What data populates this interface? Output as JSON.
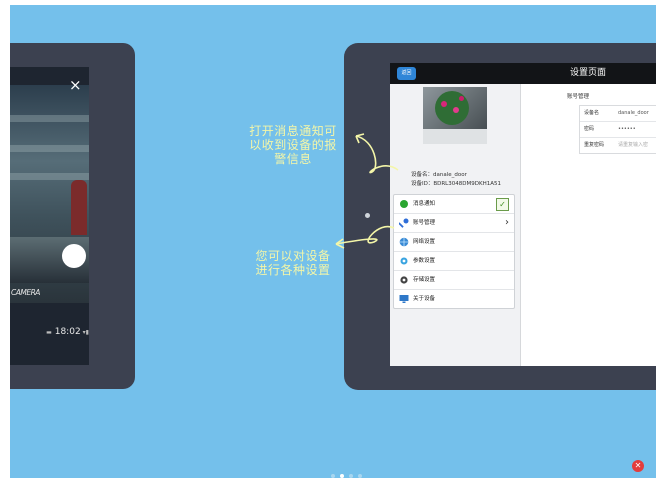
{
  "left_tablet": {
    "close_glyph": "×",
    "camera_label": "CAMERA",
    "status_time": "18:02"
  },
  "settings": {
    "back_label": "返回",
    "title": "设置页面",
    "device_name_line": "设备名：danale_door",
    "device_id_line": "设备ID：BDRL3048DM9DKH1A51",
    "menu": [
      {
        "label": "消息通知",
        "icon": "green-dot-icon",
        "accessory": "checkbox",
        "checked": true
      },
      {
        "label": "账号管理",
        "icon": "key-icon",
        "accessory": "chevron"
      },
      {
        "label": "网络设置",
        "icon": "globe-icon"
      },
      {
        "label": "参数设置",
        "icon": "gear-blue-icon"
      },
      {
        "label": "存储设置",
        "icon": "cog-icon"
      },
      {
        "label": "关于设备",
        "icon": "monitor-icon"
      }
    ],
    "account": {
      "header": "账号管理",
      "rows": [
        {
          "key": "设备名",
          "value": "danale_door"
        },
        {
          "key": "密码",
          "value": "••••••"
        },
        {
          "key": "重复密码",
          "value": "请重复输入密"
        }
      ]
    },
    "checkmark": "✓",
    "chevron": "›"
  },
  "annotations": {
    "note1_line1": "打开消息通知可",
    "note1_line2": "以收到设备的报",
    "note1_line3": "警信息",
    "note2_line1": "您可以对设备",
    "note2_line2": "进行各种设置"
  },
  "close_button_glyph": "✕",
  "colors": {
    "background": "#74c0eb",
    "tablet_frame": "#3c4150",
    "note": "#f4f6a8",
    "accent_blue": "#2f86d8",
    "close_red": "#e33d3d"
  }
}
